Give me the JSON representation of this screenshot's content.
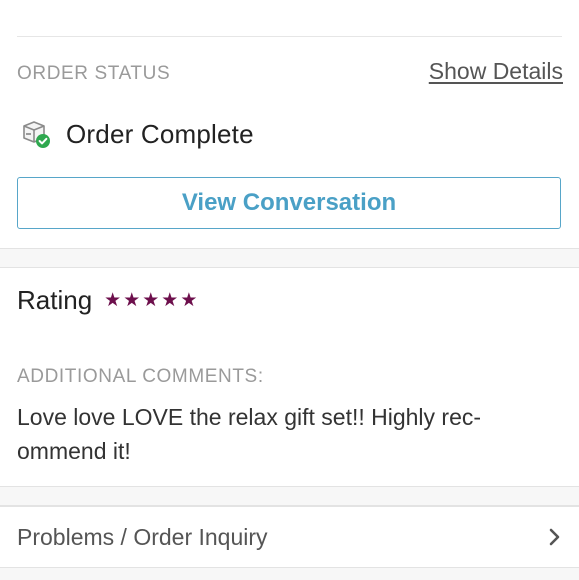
{
  "order_status": {
    "section_label": "ORDER STATUS",
    "show_details_label": "Show Details",
    "status_text": "Order Complete",
    "view_conversation_label": "View Conversation"
  },
  "rating": {
    "label": "Rating",
    "stars": 5,
    "star_color": "#6d0f4c"
  },
  "comments": {
    "label": "ADDITIONAL COMMENTS:",
    "text": "Love love LOVE the relax gift set!! Highly rec-ommend it!"
  },
  "inquiry": {
    "label": "Problems / Order Inquiry"
  },
  "icons": {
    "status_icon": "package-check-icon",
    "inquiry_chevron": "chevron-right-icon"
  },
  "colors": {
    "accent_blue": "#4aa0c6",
    "check_green": "#2fa84f"
  }
}
